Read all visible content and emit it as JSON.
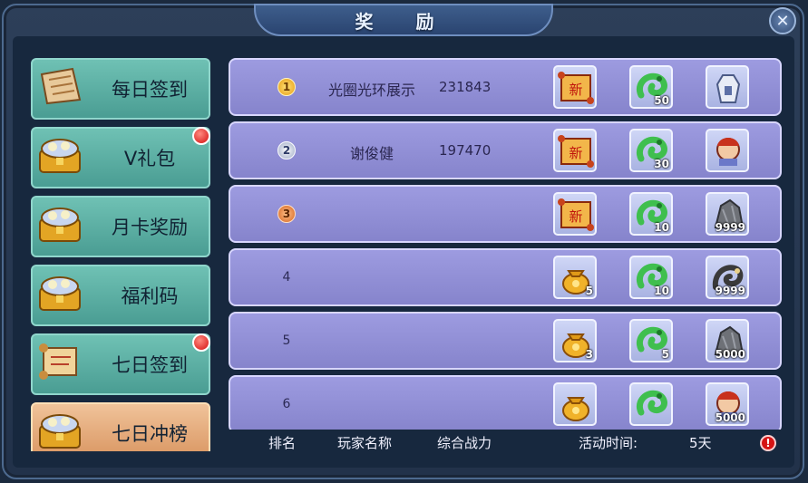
{
  "window": {
    "title": "奖 励",
    "close_icon": "close-icon"
  },
  "sidebar": {
    "items": [
      {
        "label": "每日签到",
        "icon": "scroll-icon",
        "badge": false,
        "active": false
      },
      {
        "label": "V礼包",
        "icon": "treasure-chest-icon",
        "badge": true,
        "active": false
      },
      {
        "label": "月卡奖励",
        "icon": "treasure-chest-icon",
        "badge": false,
        "active": false
      },
      {
        "label": "福利码",
        "icon": "treasure-chest-icon",
        "badge": false,
        "active": false
      },
      {
        "label": "七日签到",
        "icon": "scroll-icon",
        "badge": true,
        "active": false
      },
      {
        "label": "七日冲榜",
        "icon": "treasure-chest-icon",
        "badge": false,
        "active": true
      }
    ]
  },
  "ranking": {
    "rows": [
      {
        "rank": "1",
        "medal": "gold",
        "name": "光圈光环展示",
        "score": "231843",
        "rewards": [
          {
            "icon": "new-scroll-icon",
            "qty": ""
          },
          {
            "icon": "green-dragon-icon",
            "qty": "50"
          },
          {
            "icon": "white-outfit-icon",
            "qty": ""
          }
        ]
      },
      {
        "rank": "2",
        "medal": "silver",
        "name": "谢俊健",
        "score": "197470",
        "rewards": [
          {
            "icon": "new-scroll-icon",
            "qty": ""
          },
          {
            "icon": "green-dragon-icon",
            "qty": "30"
          },
          {
            "icon": "character-portrait-icon",
            "qty": ""
          }
        ]
      },
      {
        "rank": "3",
        "medal": "bronze",
        "name": "",
        "score": "",
        "rewards": [
          {
            "icon": "new-scroll-icon",
            "qty": ""
          },
          {
            "icon": "green-dragon-icon",
            "qty": "10"
          },
          {
            "icon": "stone-icon",
            "qty": "9999"
          }
        ]
      },
      {
        "rank": "4",
        "medal": "",
        "name": "",
        "score": "",
        "rewards": [
          {
            "icon": "gold-bag-icon",
            "qty": "5"
          },
          {
            "icon": "green-dragon-icon",
            "qty": "10"
          },
          {
            "icon": "dark-dragon-icon",
            "qty": "9999"
          }
        ]
      },
      {
        "rank": "5",
        "medal": "",
        "name": "",
        "score": "",
        "rewards": [
          {
            "icon": "gold-bag-icon",
            "qty": "3"
          },
          {
            "icon": "green-dragon-icon",
            "qty": "5"
          },
          {
            "icon": "stone-icon",
            "qty": "5000"
          }
        ]
      },
      {
        "rank": "6",
        "medal": "",
        "name": "",
        "score": "",
        "rewards": [
          {
            "icon": "gold-bag-icon",
            "qty": ""
          },
          {
            "icon": "green-dragon-icon",
            "qty": ""
          },
          {
            "icon": "character-portrait-icon",
            "qty": "5000"
          }
        ]
      }
    ]
  },
  "footer": {
    "col_rank": "排名",
    "col_name": "玩家名称",
    "col_power": "综合战力",
    "time_label": "活动时间:",
    "time_value": "5天",
    "info_icon": "warning-icon",
    "info_symbol": "!"
  },
  "colors": {
    "row": "#9d9be0",
    "sidebar": "#6fc1b4",
    "sidebar_active": "#f0c39a",
    "badge": "#d40f0f"
  }
}
